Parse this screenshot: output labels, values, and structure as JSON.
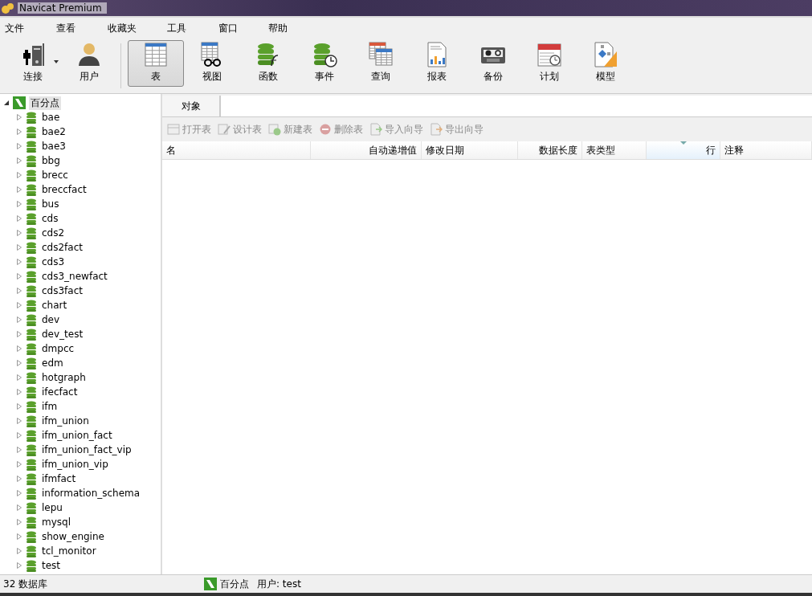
{
  "window": {
    "title": "Navicat Premium"
  },
  "menu": [
    "文件",
    "查看",
    "收藏夹",
    "工具",
    "窗口",
    "帮助"
  ],
  "toolbar": [
    {
      "label": "连接",
      "kind": "connect",
      "selected": false,
      "dropdown": true
    },
    {
      "label": "用户",
      "kind": "user",
      "selected": false,
      "dropdown": false
    },
    {
      "label": "表",
      "kind": "table",
      "selected": true,
      "dropdown": false
    },
    {
      "label": "视图",
      "kind": "view",
      "selected": false,
      "dropdown": false
    },
    {
      "label": "函数",
      "kind": "function",
      "selected": false,
      "dropdown": false
    },
    {
      "label": "事件",
      "kind": "event",
      "selected": false,
      "dropdown": false
    },
    {
      "label": "查询",
      "kind": "query",
      "selected": false,
      "dropdown": false
    },
    {
      "label": "报表",
      "kind": "report",
      "selected": false,
      "dropdown": false
    },
    {
      "label": "备份",
      "kind": "backup",
      "selected": false,
      "dropdown": false
    },
    {
      "label": "计划",
      "kind": "schedule",
      "selected": false,
      "dropdown": false
    },
    {
      "label": "模型",
      "kind": "model",
      "selected": false,
      "dropdown": false
    }
  ],
  "tree": [
    {
      "label": "百分点",
      "expanded": true,
      "selected": true,
      "children": [
        {
          "label": "bae",
          "expanded": false
        },
        {
          "label": "bae2",
          "expanded": false
        },
        {
          "label": "bae3",
          "expanded": false
        },
        {
          "label": "bbg",
          "expanded": false
        },
        {
          "label": "brecc",
          "expanded": false
        },
        {
          "label": "breccfact",
          "expanded": false
        },
        {
          "label": "bus",
          "expanded": false
        },
        {
          "label": "cds",
          "expanded": false
        },
        {
          "label": "cds2",
          "expanded": false
        },
        {
          "label": "cds2fact",
          "expanded": false
        },
        {
          "label": "cds3",
          "expanded": false
        },
        {
          "label": "cds3_newfact",
          "expanded": false
        },
        {
          "label": "cds3fact",
          "expanded": false
        },
        {
          "label": "chart",
          "expanded": false
        },
        {
          "label": "dev",
          "expanded": false
        },
        {
          "label": "dev_test",
          "expanded": false
        },
        {
          "label": "dmpcc",
          "expanded": false
        },
        {
          "label": "edm",
          "expanded": false
        },
        {
          "label": "hotgraph",
          "expanded": false
        },
        {
          "label": "ifecfact",
          "expanded": false
        },
        {
          "label": "ifm",
          "expanded": false
        },
        {
          "label": "ifm_union",
          "expanded": false
        },
        {
          "label": "ifm_union_fact",
          "expanded": false
        },
        {
          "label": "ifm_union_fact_vip",
          "expanded": false
        },
        {
          "label": "ifm_union_vip",
          "expanded": false
        },
        {
          "label": "ifmfact",
          "expanded": false
        },
        {
          "label": "information_schema",
          "expanded": false
        },
        {
          "label": "lepu",
          "expanded": false
        },
        {
          "label": "mysql",
          "expanded": false
        },
        {
          "label": "show_engine",
          "expanded": false
        },
        {
          "label": "tcl_monitor",
          "expanded": false
        },
        {
          "label": "test",
          "expanded": false
        }
      ]
    }
  ],
  "tabs": [
    {
      "label": "对象",
      "selected": true
    }
  ],
  "object_toolbar": [
    {
      "label": "打开表",
      "kind": "open",
      "disabled": true
    },
    {
      "label": "设计表",
      "kind": "design",
      "disabled": true
    },
    {
      "label": "新建表",
      "kind": "new",
      "disabled": true
    },
    {
      "label": "删除表",
      "kind": "delete",
      "disabled": true
    },
    {
      "label": "导入向导",
      "kind": "import",
      "disabled": true
    },
    {
      "label": "导出向导",
      "kind": "export",
      "disabled": true
    }
  ],
  "table": {
    "columns": [
      {
        "label": "名",
        "kind": "text",
        "sorted": false
      },
      {
        "label": "自动递增值",
        "kind": "number",
        "sorted": false
      },
      {
        "label": "修改日期",
        "kind": "text",
        "sorted": false
      },
      {
        "label": "数据长度",
        "kind": "number",
        "sorted": false
      },
      {
        "label": "表类型",
        "kind": "text",
        "sorted": false
      },
      {
        "label": "行",
        "kind": "number",
        "sorted": true
      },
      {
        "label": "注释",
        "kind": "text",
        "sorted": false
      }
    ]
  },
  "status_bar": {
    "count": "32 数据库",
    "connection": "百分点",
    "user": "用户: test"
  }
}
